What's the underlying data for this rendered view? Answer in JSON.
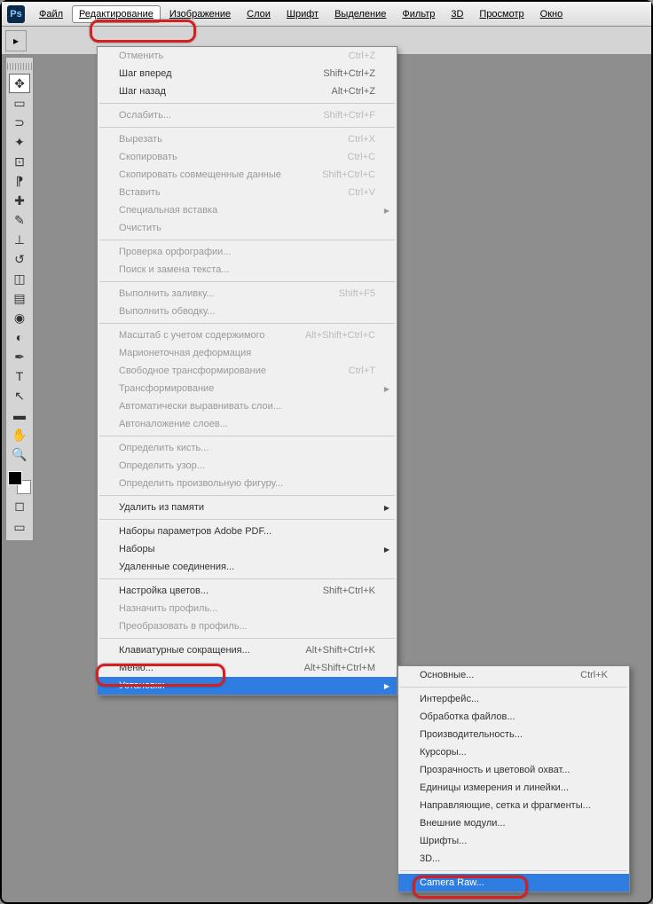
{
  "app": {
    "logo_text": "Ps"
  },
  "menu": {
    "items": [
      "Файл",
      "Редактирование",
      "Изображение",
      "Слои",
      "Шрифт",
      "Выделение",
      "Фильтр",
      "3D",
      "Просмотр",
      "Окно"
    ],
    "active_index": 1
  },
  "edit_menu": {
    "groups": [
      [
        {
          "label": "Отменить",
          "shortcut": "Ctrl+Z",
          "disabled": true
        },
        {
          "label": "Шаг вперед",
          "shortcut": "Shift+Ctrl+Z"
        },
        {
          "label": "Шаг назад",
          "shortcut": "Alt+Ctrl+Z"
        }
      ],
      [
        {
          "label": "Ослабить...",
          "shortcut": "Shift+Ctrl+F",
          "disabled": true
        }
      ],
      [
        {
          "label": "Вырезать",
          "shortcut": "Ctrl+X",
          "disabled": true
        },
        {
          "label": "Скопировать",
          "shortcut": "Ctrl+C",
          "disabled": true
        },
        {
          "label": "Скопировать совмещенные данные",
          "shortcut": "Shift+Ctrl+C",
          "disabled": true
        },
        {
          "label": "Вставить",
          "shortcut": "Ctrl+V",
          "disabled": true
        },
        {
          "label": "Специальная вставка",
          "submenu": true,
          "disabled": true
        },
        {
          "label": "Очистить",
          "disabled": true
        }
      ],
      [
        {
          "label": "Проверка орфографии...",
          "disabled": true
        },
        {
          "label": "Поиск и замена текста...",
          "disabled": true
        }
      ],
      [
        {
          "label": "Выполнить заливку...",
          "shortcut": "Shift+F5",
          "disabled": true
        },
        {
          "label": "Выполнить обводку...",
          "disabled": true
        }
      ],
      [
        {
          "label": "Масштаб с учетом содержимого",
          "shortcut": "Alt+Shift+Ctrl+C",
          "disabled": true
        },
        {
          "label": "Марионеточная деформация",
          "disabled": true
        },
        {
          "label": "Свободное трансформирование",
          "shortcut": "Ctrl+T",
          "disabled": true
        },
        {
          "label": "Трансформирование",
          "submenu": true,
          "disabled": true
        },
        {
          "label": "Автоматически выравнивать слои...",
          "disabled": true
        },
        {
          "label": "Автоналожение слоев...",
          "disabled": true
        }
      ],
      [
        {
          "label": "Определить кисть...",
          "disabled": true
        },
        {
          "label": "Определить узор...",
          "disabled": true
        },
        {
          "label": "Определить произвольную фигуру...",
          "disabled": true
        }
      ],
      [
        {
          "label": "Удалить из памяти",
          "submenu": true
        }
      ],
      [
        {
          "label": "Наборы параметров Adobe PDF..."
        },
        {
          "label": "Наборы",
          "submenu": true
        },
        {
          "label": "Удаленные соединения..."
        }
      ],
      [
        {
          "label": "Настройка цветов...",
          "shortcut": "Shift+Ctrl+K"
        },
        {
          "label": "Назначить профиль...",
          "disabled": true
        },
        {
          "label": "Преобразовать в профиль...",
          "disabled": true
        }
      ],
      [
        {
          "label": "Клавиатурные сокращения...",
          "shortcut": "Alt+Shift+Ctrl+K"
        },
        {
          "label": "Меню...",
          "shortcut": "Alt+Shift+Ctrl+M"
        },
        {
          "label": "Установки",
          "submenu": true,
          "highlighted": true
        }
      ]
    ]
  },
  "preferences_submenu": {
    "groups": [
      [
        {
          "label": "Основные...",
          "shortcut": "Ctrl+K"
        }
      ],
      [
        {
          "label": "Интерфейс..."
        },
        {
          "label": "Обработка файлов..."
        },
        {
          "label": "Производительность..."
        },
        {
          "label": "Курсоры..."
        },
        {
          "label": "Прозрачность и цветовой охват..."
        },
        {
          "label": "Единицы измерения и линейки..."
        },
        {
          "label": "Направляющие, сетка и фрагменты..."
        },
        {
          "label": "Внешние модули..."
        },
        {
          "label": "Шрифты..."
        },
        {
          "label": "3D..."
        }
      ],
      [
        {
          "label": "Camera Raw...",
          "highlighted": true
        }
      ]
    ]
  },
  "tools": [
    "move",
    "marquee",
    "lasso",
    "wand",
    "crop",
    "eyedropper",
    "healing",
    "brush",
    "stamp",
    "history-brush",
    "eraser",
    "gradient",
    "blur",
    "dodge",
    "pen",
    "type",
    "path-select",
    "shape",
    "hand",
    "zoom"
  ]
}
